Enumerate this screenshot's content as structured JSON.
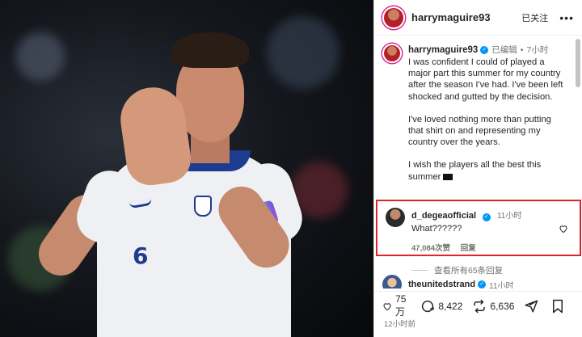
{
  "header": {
    "username": "harrymaguire93",
    "follow_status": "已关注",
    "more": "•••"
  },
  "post": {
    "username": "harrymaguire93",
    "edited": "已编辑",
    "separator": "•",
    "time": "7小时",
    "caption_paragraphs": [
      "I was confident I could of played a major part this summer for my country after the season I've had. I've been left shocked and gutted by the decision.",
      "I've loved nothing more than putting that shirt on and representing my country over the years.",
      "I wish the players all the best this summer"
    ]
  },
  "comment": {
    "username": "d_degeaofficial",
    "time": "11小时",
    "text": "What??????",
    "likes": "47,084次赞",
    "reply": "回复"
  },
  "view_replies": "查看所有65条回复",
  "next_comment": {
    "username": "theunitedstrand",
    "time": "11小时"
  },
  "actions": {
    "likes": "75 万",
    "comments": "8,422",
    "reposts": "6,636"
  },
  "timestamp": "12小时前",
  "photo": {
    "jersey_number": "6"
  }
}
